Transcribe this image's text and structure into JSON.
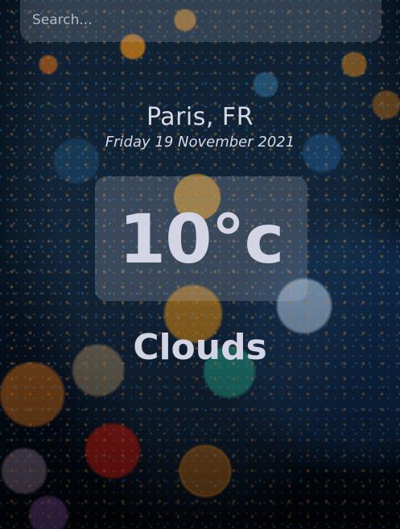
{
  "search": {
    "placeholder": "Search...",
    "value": ""
  },
  "location": {
    "city": "Paris, FR",
    "date": "Friday 19 November 2021"
  },
  "weather": {
    "temperature": "10°c",
    "condition": "Clouds"
  },
  "colors": {
    "text": "#d6d8e6",
    "panel_overlay": "rgba(200,200,215,0.22)",
    "background_dark": "#050b14"
  }
}
